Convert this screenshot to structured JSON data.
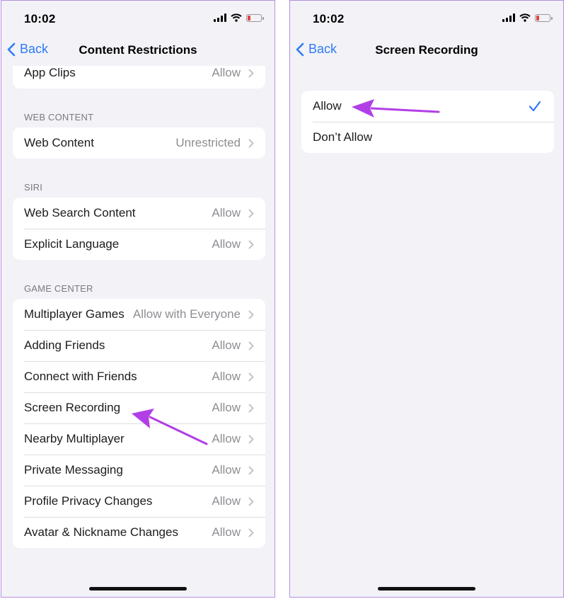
{
  "left_screen": {
    "status": {
      "time": "10:02"
    },
    "nav": {
      "back_label": "Back",
      "title": "Content Restrictions"
    },
    "top_row": {
      "label": "App Clips",
      "value": "Allow"
    },
    "sections": [
      {
        "header": "WEB CONTENT",
        "rows": [
          {
            "label": "Web Content",
            "value": "Unrestricted"
          }
        ]
      },
      {
        "header": "SIRI",
        "rows": [
          {
            "label": "Web Search Content",
            "value": "Allow"
          },
          {
            "label": "Explicit Language",
            "value": "Allow"
          }
        ]
      },
      {
        "header": "GAME CENTER",
        "rows": [
          {
            "label": "Multiplayer Games",
            "value": "Allow with Everyone"
          },
          {
            "label": "Adding Friends",
            "value": "Allow"
          },
          {
            "label": "Connect with Friends",
            "value": "Allow"
          },
          {
            "label": "Screen Recording",
            "value": "Allow"
          },
          {
            "label": "Nearby Multiplayer",
            "value": "Allow"
          },
          {
            "label": "Private Messaging",
            "value": "Allow"
          },
          {
            "label": "Profile Privacy Changes",
            "value": "Allow"
          },
          {
            "label": "Avatar & Nickname Changes",
            "value": "Allow"
          }
        ]
      }
    ]
  },
  "right_screen": {
    "status": {
      "time": "10:02"
    },
    "nav": {
      "back_label": "Back",
      "title": "Screen Recording"
    },
    "options": [
      {
        "label": "Allow",
        "selected": true
      },
      {
        "label": "Don’t Allow",
        "selected": false
      }
    ]
  },
  "colors": {
    "accent": "#2f7bf6",
    "arrow": "#b23fe6",
    "background": "#f2f2f7",
    "battery_low": "#e0443e"
  },
  "icons": [
    "signal-icon",
    "wifi-icon",
    "battery-icon",
    "back-chevron-icon",
    "chevron-right-icon",
    "checkmark-icon",
    "pointer-arrow"
  ]
}
